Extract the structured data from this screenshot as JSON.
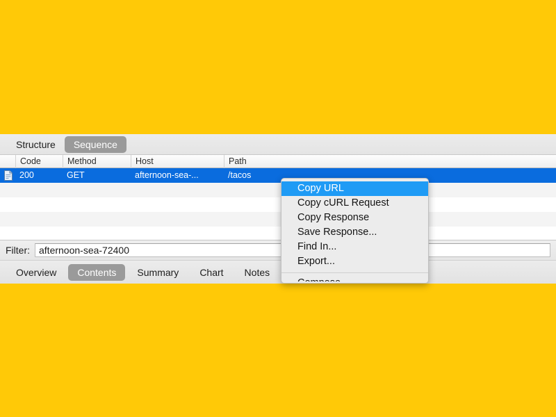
{
  "background": {
    "color": "#FFC907"
  },
  "app": {
    "segmented_control": {
      "name": "structure-sequence-toggle",
      "options": [
        {
          "label": "Structure",
          "selected": false
        },
        {
          "label": "Sequence",
          "selected": true
        }
      ]
    },
    "table": {
      "columns": [
        "Code",
        "Method",
        "Host",
        "Path"
      ],
      "rows": [
        {
          "icon": "document-icon",
          "code": "200",
          "method": "GET",
          "host": "afternoon-sea-...",
          "path": "/tacos",
          "selected": true
        }
      ]
    },
    "filter": {
      "label": "Filter:",
      "value": "afternoon-sea-72400",
      "placeholder": ""
    },
    "bottom_tabs": [
      {
        "label": "Overview",
        "selected": false
      },
      {
        "label": "Contents",
        "selected": true
      },
      {
        "label": "Summary",
        "selected": false
      },
      {
        "label": "Chart",
        "selected": false
      },
      {
        "label": "Notes",
        "selected": false
      }
    ]
  },
  "context_menu": {
    "items": [
      {
        "label": "Copy URL",
        "highlighted": true
      },
      {
        "label": "Copy cURL Request",
        "highlighted": false
      },
      {
        "label": "Copy Response",
        "highlighted": false
      },
      {
        "label": "Save Response...",
        "highlighted": false
      },
      {
        "label": "Find In...",
        "highlighted": false
      },
      {
        "label": "Export...",
        "highlighted": false
      }
    ],
    "clipped_item": {
      "label": "Compose"
    },
    "colors": {
      "highlight": "#1f9bf5",
      "background": "#ececec"
    }
  },
  "colors": {
    "selection_blue": "#0a6cde",
    "segment_selected": "#9a9a9a",
    "accent_yellow": "#FFC907"
  }
}
